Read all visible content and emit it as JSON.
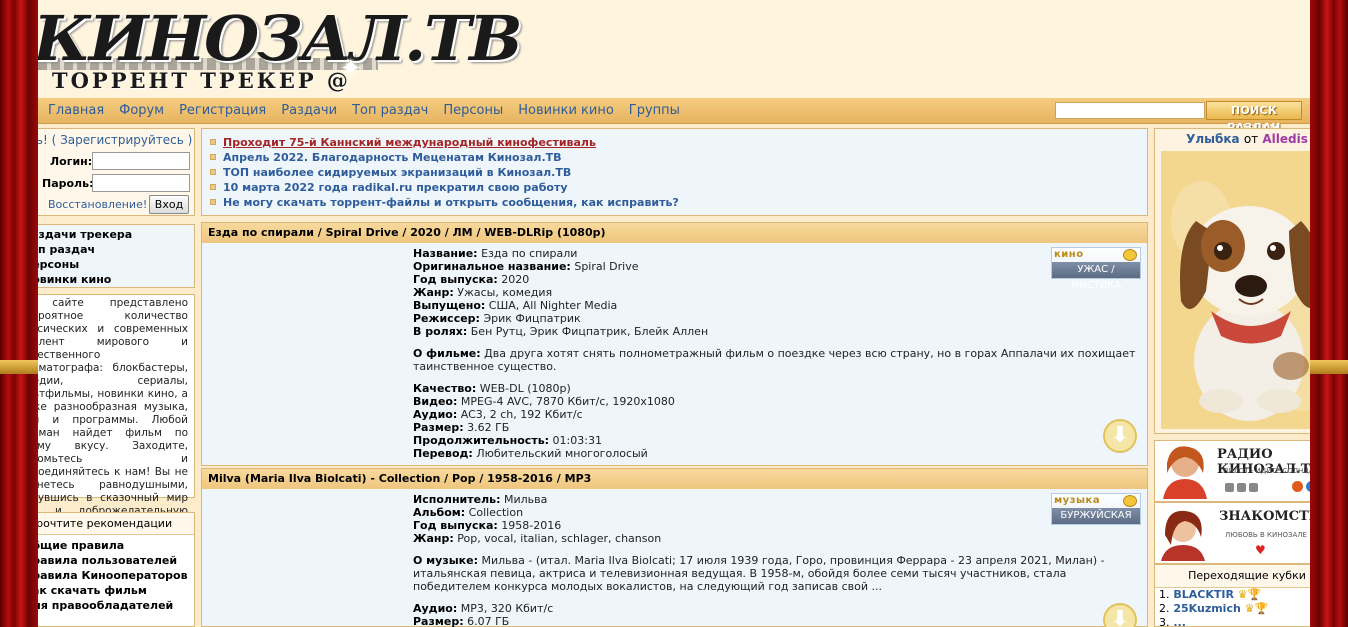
{
  "site": {
    "logo_title": "КИНОЗАЛ.ТВ",
    "logo_subtitle": "ТОРРЕНТ ТРЕКЕР @"
  },
  "nav": {
    "links": [
      "Главная",
      "Форум",
      "Регистрация",
      "Раздачи",
      "Топ раздач",
      "Персоны",
      "Новинки кино",
      "Группы"
    ],
    "search_placeholder": "",
    "search_button": "ПОИСК РАЗДАЧ"
  },
  "login": {
    "guest": "Гость! ( Зарегистрируйтесь )",
    "login_label": "Логин:",
    "password_label": "Пароль:",
    "restore": "Восстановление!",
    "submit": "Вход"
  },
  "side_menu": [
    "Раздачи трекера",
    "Топ раздач",
    "Персоны",
    "Новинки кино"
  ],
  "about_text": "На сайте представлено невероятное количество классических и современных кинолент мирового и отечественного кинематографа: блокбастеры, комедии, сериалы, мультфильмы, новинки кино, а также разнообразная музыка, игры и программы. Любой киноман найдет фильм по своему вкусу. Заходите, знакомьтесь и присоединяйтесь к нам! Вы не останетесь равнодушными, окунувшись в сказочный мир кино и доброжелательную атмосферу.",
  "recommend": {
    "title": "Прочтите рекомендации",
    "items": [
      "Общие правила",
      "Правила пользователей",
      "Правила Кинооператоров",
      "Как скачать фильм",
      "Для правообладателей"
    ]
  },
  "news": [
    "Проходит 75-й Каннский международный кинофестиваль",
    "Апрель 2022. Благодарность Меценатам Кинозал.ТВ",
    "ТОП наиболее сидируемых экранизаций в Кинозал.ТВ",
    "10 марта 2022 года radikal.ru прекратил свою работу",
    "Не могу скачать торрент-файлы и открыть сообщения, как исправить?"
  ],
  "topics": [
    {
      "title": "Езда по спирали / Spiral Drive / 2020 / ЛМ / WEB-DLRip (1080p)",
      "badge_top": "кино",
      "badge_bottom": "УЖАС / МИСТИКА",
      "props": {
        "name_k": "Название:",
        "name_v": "Езда по спирали",
        "orig_k": "Оригинальное название:",
        "orig_v": "Spiral Drive",
        "year_k": "Год выпуска:",
        "year_v": "2020",
        "genre_k": "Жанр:",
        "genre_v": "Ужасы, комедия",
        "made_k": "Выпущено:",
        "made_v": "США, All Nighter Media",
        "dir_k": "Режиссер:",
        "dir_v": "Эрик Фицпатрик",
        "cast_k": "В ролях:",
        "cast_v": "Бен Рутц, Эрик Фицпатрик, Блейк Аллен",
        "about_k": "О фильме:",
        "about_v": "Два друга хотят снять полнометражный фильм о поездке через всю страну, но в горах Аппалачи их похищает таинственное существо.",
        "quality_k": "Качество:",
        "quality_v": "WEB-DL (1080p)",
        "video_k": "Видео:",
        "video_v": "MPEG-4 AVC, 7870 Кбит/с, 1920x1080",
        "audio_k": "Аудио:",
        "audio_v": "AC3, 2 ch, 192 Кбит/с",
        "size_k": "Размер:",
        "size_v": "3.62 ГБ",
        "dur_k": "Продолжительность:",
        "dur_v": "01:03:31",
        "trans_k": "Перевод:",
        "trans_v": "Любительский многоголосый"
      }
    },
    {
      "title": "Milva (Maria Ilva Biolcati) - Collection / Pop / 1958-2016 / MP3",
      "badge_top": "музыка",
      "badge_bottom": "БУРЖУЙСКАЯ",
      "props": {
        "artist_k": "Исполнитель:",
        "artist_v": "Мильва",
        "album_k": "Альбом:",
        "album_v": "Collection",
        "year_k": "Год выпуска:",
        "year_v": "1958-2016",
        "genre_k": "Жанр:",
        "genre_v": "Pop, vocal, italian, schlager, chanson",
        "about_k": "О музыке:",
        "about_v": "Мильва - (итал. Maria Ilva Biolcati; 17 июля 1939 года, Горо, провинция Феррара - 23 апреля 2021, Милан) - итальянская певица, актриса и телевизионная ведущая. В 1958-м, обойдя более семи тысяч участников, стала победителем конкурса молодых вокалистов, на следующий год записав свой ...",
        "audio_k": "Аудио:",
        "audio_v": "MP3, 320 Кбит/с",
        "size_k": "Размер:",
        "size_v": "6.07 ГБ"
      }
    }
  ],
  "smile": {
    "label": "Улыбка",
    "from": "от",
    "author": "Alledis"
  },
  "radio": {
    "title": "РАДИО КИНОЗАЛ.ТВ",
    "subtitle": "ПИЛОТ - ИДИТЕ СОЛНЦА"
  },
  "dating": {
    "title": "ЗНАКОМСТВА",
    "subtitle": "ЛЮБОВЬ В КИНОЗАЛЕ"
  },
  "cups": {
    "title": "Переходящие кубки",
    "rows": [
      {
        "num": "1.",
        "name": "BLACKTIR"
      },
      {
        "num": "2.",
        "name": "25Kuzmich"
      },
      {
        "num": "3.",
        "name": "..."
      }
    ]
  },
  "colors": {
    "background": "#fdeccb",
    "link": "#2f5d9a",
    "navbar": "#efc67f",
    "curtain": "#b40d0d"
  }
}
